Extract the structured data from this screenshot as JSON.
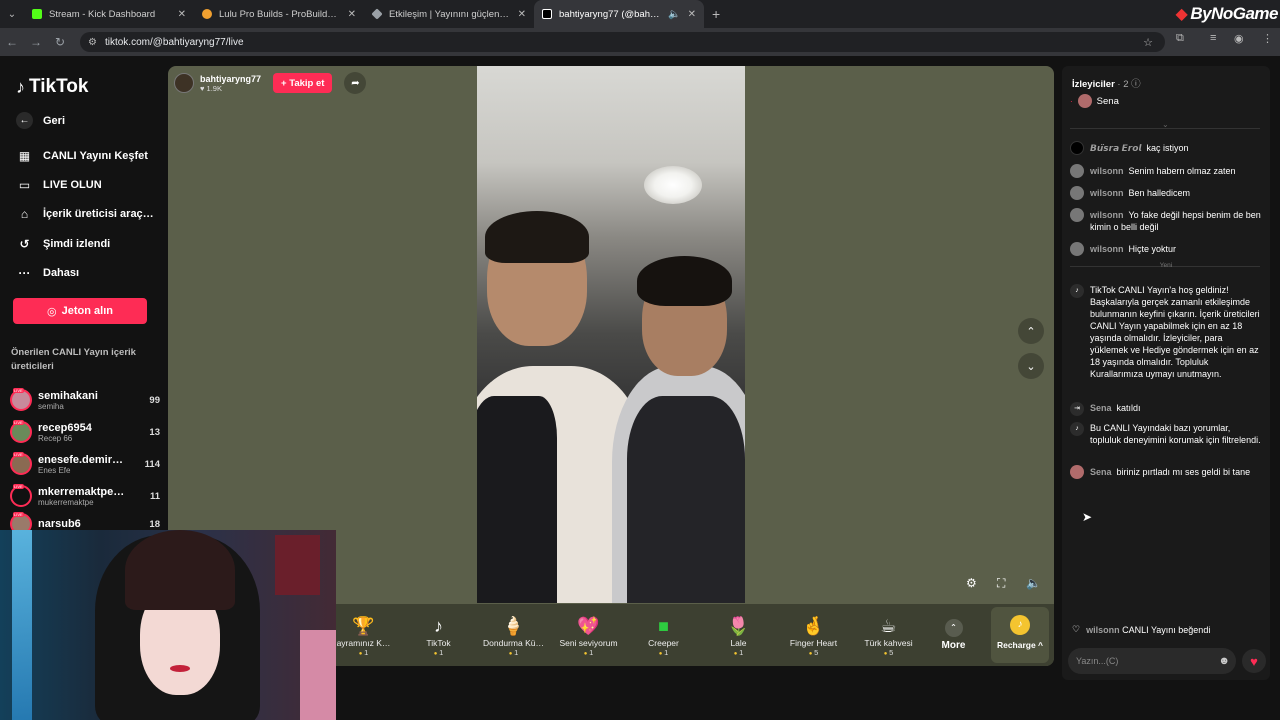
{
  "browser": {
    "tabs": [
      {
        "title": "Stream - Kick Dashboard",
        "color": "#53fc18"
      },
      {
        "title": "Lulu Pro Builds - ProBuilds.net",
        "color": "#f0a030"
      },
      {
        "title": "Etkileşim | Yayınını güçlendirme",
        "color": "#9aa0a6"
      },
      {
        "title": "bahtiyaryng77 (@bahtiyaryn",
        "color": "#ffffff"
      }
    ],
    "url": "tiktok.com/@bahtiyaryng77/live",
    "brand": "ByNoGame"
  },
  "sidebar": {
    "logo": "TikTok",
    "back": "Geri",
    "nav": [
      {
        "label": "CANLI Yayını Keşfet",
        "icon": "calendar-live-icon"
      },
      {
        "label": "LIVE OLUN",
        "icon": "camera-icon"
      },
      {
        "label": "İçerik üreticisi araç…",
        "icon": "home-tools-icon"
      },
      {
        "label": "Şimdi izlendi",
        "icon": "history-icon"
      },
      {
        "label": "Dahası",
        "icon": "more-dots-icon"
      }
    ],
    "coin_button": "Jeton alın",
    "suggest_title": "Önerilen CANLI Yayın içerik üreticileri",
    "creators": [
      {
        "name": "semihakani",
        "sub": "semiha",
        "count": "99"
      },
      {
        "name": "recep6954",
        "sub": "Recep 66",
        "count": "13"
      },
      {
        "name": "enesefe.demir…",
        "sub": "Enes Efe",
        "count": "114"
      },
      {
        "name": "mkerremaktpe…",
        "sub": "mukerremaktpe",
        "count": "11"
      },
      {
        "name": "narsub6",
        "sub": "",
        "count": "18"
      }
    ]
  },
  "stream": {
    "host": "bahtiyaryng77",
    "likes": "1.9K",
    "follow": "+ Takip et"
  },
  "gifts": [
    {
      "name": "ayramınız K…",
      "price": "1",
      "icon": "🏆"
    },
    {
      "name": "TikTok",
      "price": "1",
      "icon": "♪"
    },
    {
      "name": "Dondurma Kü…",
      "price": "1",
      "icon": "🍦"
    },
    {
      "name": "Seni seviyorum",
      "price": "1",
      "icon": "💖"
    },
    {
      "name": "Creeper",
      "price": "1",
      "icon": "🟩"
    },
    {
      "name": "Lale",
      "price": "1",
      "icon": "🌷"
    },
    {
      "name": "Finger Heart",
      "price": "5",
      "icon": "🤞"
    },
    {
      "name": "Türk kahvesi",
      "price": "5",
      "icon": "☕"
    }
  ],
  "gift_more": "More",
  "recharge": "Recharge ^",
  "chat": {
    "viewers_label": "İzleyiciler",
    "viewers_count": "· 2",
    "viewer_name": "Sena",
    "messages": [
      {
        "user": "𝘽𝙪̈𝙨𝙧𝙖 𝙀𝙧𝙤𝙡",
        "text": "kaç istiyon"
      },
      {
        "user": "wilsonn",
        "text": "Senim habern olmaz zaten"
      },
      {
        "user": "wilsonn",
        "text": "Ben halledicem"
      },
      {
        "user": "wilsonn",
        "text": "Yo fake değil hepsi benim de ben kimin o belli değil"
      },
      {
        "user": "wilsonn",
        "text": "Hiçte yoktur"
      }
    ],
    "new_label": "Yeni",
    "system1": "TikTok CANLI Yayın'a hoş geldiniz! Başkalarıyla gerçek zamanlı etkileşimde bulunmanın keyfini çıkarın. İçerik üreticileri CANLI Yayın yapabilmek için en az 18 yaşında olmalıdır. İzleyiciler, para yüklemek ve Hediye göndermek için en az 18 yaşında olmalıdır. Topluluk Kurallarımıza uymayı unutmayın.",
    "joined_user": "Sena",
    "joined_text": "katıldı",
    "system2": "Bu CANLI Yayındaki bazı yorumlar, topluluk deneyimini korumak için filtrelendi.",
    "last_user": "Sena",
    "last_text": "biriniz pırtladı mı ses geldi bi tane",
    "liked_user": "wilsonn",
    "liked_text": "CANLI Yayını beğendi",
    "input_placeholder": "Yazın...(C)"
  }
}
